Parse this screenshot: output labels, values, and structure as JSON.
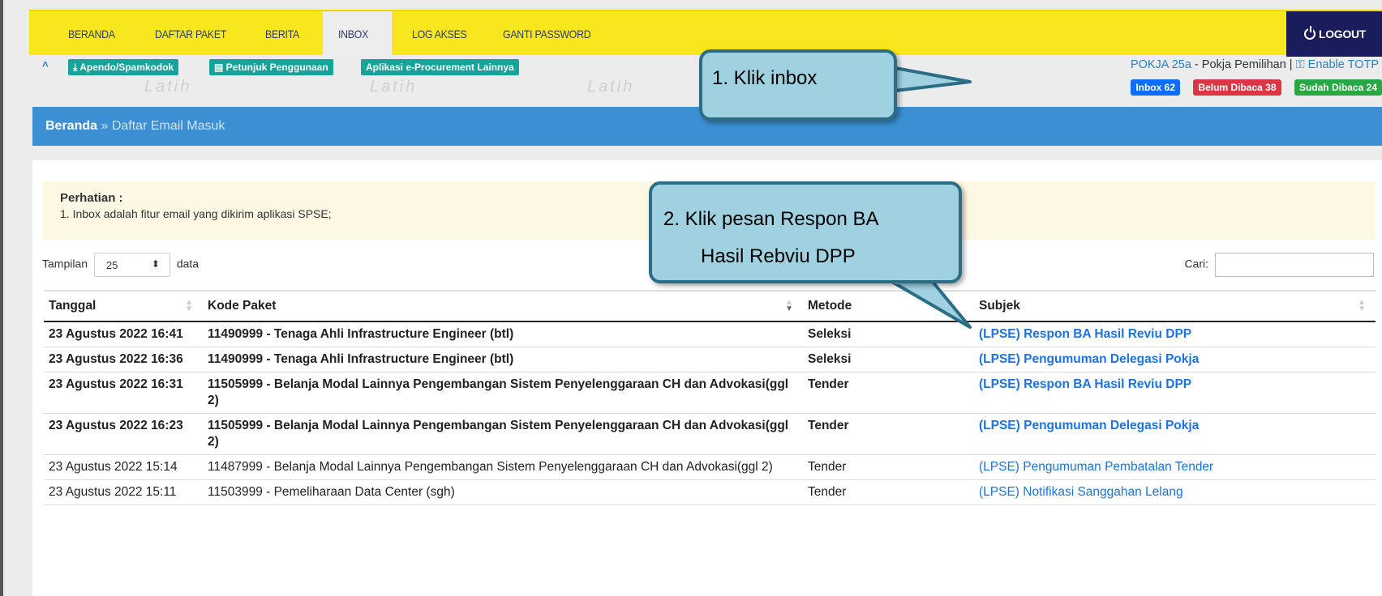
{
  "nav": {
    "items": [
      "BERANDA",
      "DAFTAR PAKET",
      "BERITA",
      "INBOX",
      "LOG AKSES",
      "GANTI PASSWORD"
    ],
    "active": "INBOX",
    "logout": "LOGOUT"
  },
  "subbar": {
    "buttons": [
      "Apendo/Spamkodok",
      "Petunjuk Penggunaan",
      "Aplikasi e-Procurement Lainnya"
    ],
    "user_group": "POKJA 25a",
    "user_role": " - Pokja Pemilihan | ",
    "totp": "Enable TOTP"
  },
  "badges": {
    "inbox": "Inbox 62",
    "unread": "Belum Dibaca 38",
    "read": "Sudah Dibaca 24"
  },
  "watermark": "Latih",
  "breadcrumb": {
    "home": "Beranda",
    "sep": " » ",
    "current": "Daftar Email Masuk"
  },
  "alert": {
    "heading": "Perhatian :",
    "text": "1. Inbox adalah fitur email yang dikirim aplikasi SPSE;"
  },
  "list": {
    "show_label": "Tampilan",
    "show_value": "25",
    "show_suffix": "data",
    "search_label": "Cari:"
  },
  "table": {
    "headers": [
      "Tanggal",
      "Kode Paket",
      "Metode",
      "Subjek"
    ],
    "rows": [
      {
        "date": "23 Agustus 2022 16:41",
        "paket": "11490999 - Tenaga Ahli Infrastructure Engineer (btl)",
        "metode": "Seleksi",
        "subjek": "(LPSE) Respon BA Hasil Reviu DPP",
        "unread": true
      },
      {
        "date": "23 Agustus 2022 16:36",
        "paket": "11490999 - Tenaga Ahli Infrastructure Engineer (btl)",
        "metode": "Seleksi",
        "subjek": "(LPSE) Pengumuman Delegasi Pokja",
        "unread": true
      },
      {
        "date": "23 Agustus 2022 16:31",
        "paket": "11505999 - Belanja Modal Lainnya Pengembangan Sistem Penyelenggaraan CH dan Advokasi(ggl 2)",
        "metode": "Tender",
        "subjek": "(LPSE) Respon BA Hasil Reviu DPP",
        "unread": true
      },
      {
        "date": "23 Agustus 2022 16:23",
        "paket": "11505999 - Belanja Modal Lainnya Pengembangan Sistem Penyelenggaraan CH dan Advokasi(ggl 2)",
        "metode": "Tender",
        "subjek": "(LPSE) Pengumuman Delegasi Pokja",
        "unread": true
      },
      {
        "date": "23 Agustus 2022 15:14",
        "paket": "11487999 - Belanja Modal Lainnya Pengembangan Sistem Penyelenggaraan CH dan Advokasi(ggl 2)",
        "metode": "Tender",
        "subjek": "(LPSE) Pengumuman Pembatalan Tender",
        "unread": false
      },
      {
        "date": "23 Agustus 2022 15:11",
        "paket": "11503999 - Pemeliharaan Data Center (sgh)",
        "metode": "Tender",
        "subjek": "(LPSE) Notifikasi Sanggahan Lelang",
        "unread": false
      }
    ]
  },
  "callouts": {
    "step1": "1.  Klik inbox",
    "step2_line1": "2.  Klik pesan Respon BA",
    "step2_line2": "Hasil Rebviu DPP"
  },
  "colors": {
    "nav_bg": "#f8e71c",
    "logout_bg": "#1a1c5c",
    "breadcrumb_bg": "#3b8fd2",
    "link_blue": "#1a73e8",
    "callout_fill": "#9fd1e1",
    "callout_border": "#2c6d86"
  }
}
